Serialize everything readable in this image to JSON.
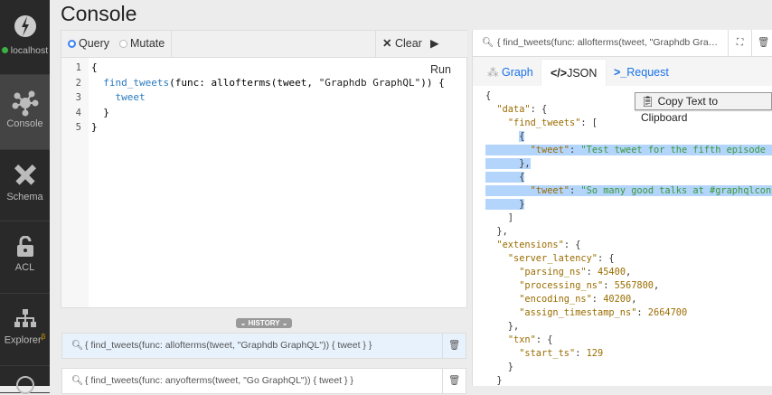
{
  "sidebar": {
    "server": "localhost",
    "server_status_color": "#3cb043",
    "items": [
      {
        "label": "Console",
        "icon": "console-icon",
        "active": true
      },
      {
        "label": "Schema",
        "icon": "pencil-ruler-icon"
      },
      {
        "label": "ACL",
        "icon": "lock-icon"
      },
      {
        "label": "Explorer",
        "icon": "sitemap-icon",
        "badge": "β"
      }
    ]
  },
  "header": {
    "title": "Console"
  },
  "editor": {
    "query_label": "Query",
    "mutate_label": "Mutate",
    "mode": "Query",
    "clear_label": "Clear",
    "run_label": "Run",
    "lines": [
      [
        {
          "c": "p",
          "v": "{"
        }
      ],
      [
        {
          "c": "p",
          "v": "  "
        },
        {
          "c": "fn",
          "v": "find_tweets"
        },
        {
          "c": "p",
          "v": "(func: allofterms(tweet, "
        },
        {
          "c": "str",
          "v": "\"Graphdb GraphQL\""
        },
        {
          "c": "p",
          "v": ")) {"
        }
      ],
      [
        {
          "c": "p",
          "v": "    "
        },
        {
          "c": "fn",
          "v": "tweet"
        }
      ],
      [
        {
          "c": "p",
          "v": "  }"
        }
      ],
      [
        {
          "c": "p",
          "v": "}"
        }
      ]
    ]
  },
  "history": {
    "label": "HISTORY",
    "items": [
      "{ find_tweets(func: allofterms(tweet, \"Graphdb GraphQL\")) { tweet } }",
      "{ find_tweets(func: anyofterms(tweet, \"Go GraphQL\")) { tweet } }"
    ]
  },
  "result": {
    "query": "{ find_tweets(func: allofterms(tweet, \"Graphdb GraphQL\")) { tweet } }",
    "tabs": [
      {
        "label": "Graph",
        "icon": "graph-icon"
      },
      {
        "label": "JSON",
        "icon": "code-icon",
        "active": true
      },
      {
        "label": "Request",
        "icon": "terminal-icon"
      }
    ],
    "copy_label": "Copy Text to Clipboard",
    "lines": [
      {
        "s": [
          {
            "c": "p",
            "v": "{"
          }
        ]
      },
      {
        "s": [
          {
            "c": "p",
            "v": "  "
          },
          {
            "c": "k",
            "v": "\"data\""
          },
          {
            "c": "p",
            "v": ": {"
          }
        ]
      },
      {
        "s": [
          {
            "c": "p",
            "v": "    "
          },
          {
            "c": "k",
            "v": "\"find_tweets\""
          },
          {
            "c": "p",
            "v": ": ["
          }
        ]
      },
      {
        "s": [
          {
            "c": "p",
            "v": "      "
          },
          {
            "c": "p",
            "v": "{",
            "h": true
          }
        ]
      },
      {
        "h": true,
        "s": [
          {
            "c": "p",
            "v": "        "
          },
          {
            "c": "k",
            "v": "\"tweet\""
          },
          {
            "c": "p",
            "v": ": "
          },
          {
            "c": "s",
            "v": "\"Test tweet for the fifth episode of"
          }
        ]
      },
      {
        "h": true,
        "s": [
          {
            "c": "p",
            "v": "      },"
          }
        ]
      },
      {
        "h": true,
        "s": [
          {
            "c": "p",
            "v": "      {"
          }
        ]
      },
      {
        "h": true,
        "s": [
          {
            "c": "p",
            "v": "        "
          },
          {
            "c": "k",
            "v": "\"tweet\""
          },
          {
            "c": "p",
            "v": ": "
          },
          {
            "c": "s",
            "v": "\"So many good talks at #graphqlconf,"
          }
        ]
      },
      {
        "h": true,
        "s": [
          {
            "c": "p",
            "v": "      }"
          }
        ]
      },
      {
        "s": [
          {
            "c": "p",
            "v": "    ]"
          }
        ]
      },
      {
        "s": [
          {
            "c": "p",
            "v": "  },"
          }
        ]
      },
      {
        "s": [
          {
            "c": "p",
            "v": "  "
          },
          {
            "c": "k",
            "v": "\"extensions\""
          },
          {
            "c": "p",
            "v": ": {"
          }
        ]
      },
      {
        "s": [
          {
            "c": "p",
            "v": "    "
          },
          {
            "c": "k",
            "v": "\"server_latency\""
          },
          {
            "c": "p",
            "v": ": {"
          }
        ]
      },
      {
        "s": [
          {
            "c": "p",
            "v": "      "
          },
          {
            "c": "k",
            "v": "\"parsing_ns\""
          },
          {
            "c": "p",
            "v": ": "
          },
          {
            "c": "n",
            "v": "45400"
          },
          {
            "c": "p",
            "v": ","
          }
        ]
      },
      {
        "s": [
          {
            "c": "p",
            "v": "      "
          },
          {
            "c": "k",
            "v": "\"processing_ns\""
          },
          {
            "c": "p",
            "v": ": "
          },
          {
            "c": "n",
            "v": "5567800"
          },
          {
            "c": "p",
            "v": ","
          }
        ]
      },
      {
        "s": [
          {
            "c": "p",
            "v": "      "
          },
          {
            "c": "k",
            "v": "\"encoding_ns\""
          },
          {
            "c": "p",
            "v": ": "
          },
          {
            "c": "n",
            "v": "40200"
          },
          {
            "c": "p",
            "v": ","
          }
        ]
      },
      {
        "s": [
          {
            "c": "p",
            "v": "      "
          },
          {
            "c": "k",
            "v": "\"assign_timestamp_ns\""
          },
          {
            "c": "p",
            "v": ": "
          },
          {
            "c": "n",
            "v": "2664700"
          }
        ]
      },
      {
        "s": [
          {
            "c": "p",
            "v": "    },"
          }
        ]
      },
      {
        "s": [
          {
            "c": "p",
            "v": "    "
          },
          {
            "c": "k",
            "v": "\"txn\""
          },
          {
            "c": "p",
            "v": ": {"
          }
        ]
      },
      {
        "s": [
          {
            "c": "p",
            "v": "      "
          },
          {
            "c": "k",
            "v": "\"start_ts\""
          },
          {
            "c": "p",
            "v": ": "
          },
          {
            "c": "n",
            "v": "129"
          }
        ]
      },
      {
        "s": [
          {
            "c": "p",
            "v": "    }"
          }
        ]
      },
      {
        "s": [
          {
            "c": "p",
            "v": "  }"
          }
        ]
      }
    ]
  }
}
